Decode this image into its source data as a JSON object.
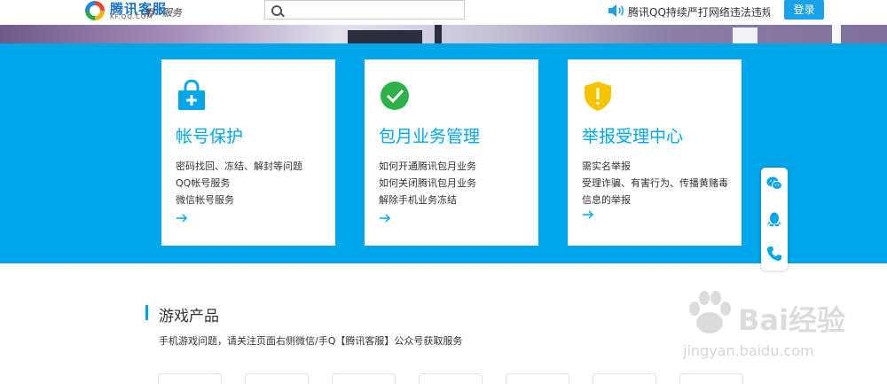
{
  "header": {
    "logo_title": "腾讯客服",
    "logo_url_text": "KF.QQ.COM",
    "slogan": "用♡服务",
    "search": {
      "value": "",
      "placeholder": ""
    },
    "notice": "腾讯QQ持续严打网络违法违规行为",
    "login_label": "登录"
  },
  "cards": [
    {
      "title": "帐号保护",
      "icon": "lock-bag-icon",
      "items": [
        "密码找回、冻结、解封等问题",
        "QQ帐号服务",
        "微信帐号服务"
      ]
    },
    {
      "title": "包月业务管理",
      "icon": "check-circle-icon",
      "items": [
        "如何开通腾讯包月业务",
        "如何关闭腾讯包月业务",
        "解除手机业务冻结"
      ]
    },
    {
      "title": "举报受理中心",
      "icon": "shield-alert-icon",
      "items": [
        "需实名举报",
        "受理诈骗、有害行为、传播黄赌毒",
        "信息的举报"
      ]
    }
  ],
  "float_bar": [
    "wechat-icon",
    "qq-penguin-icon",
    "phone-icon"
  ],
  "section": {
    "title": "游戏产品",
    "desc": "手机游戏问题，请关注页面右侧微信/手Q【腾讯客服】公众号获取服务"
  },
  "watermark": {
    "brand": "Bai经验",
    "url": "jingyan.baidu.com"
  },
  "colors": {
    "primary": "#00a6ea",
    "login": "#1aa1e8",
    "check_green": "#2db24a",
    "shield_yellow": "#f5c400"
  }
}
